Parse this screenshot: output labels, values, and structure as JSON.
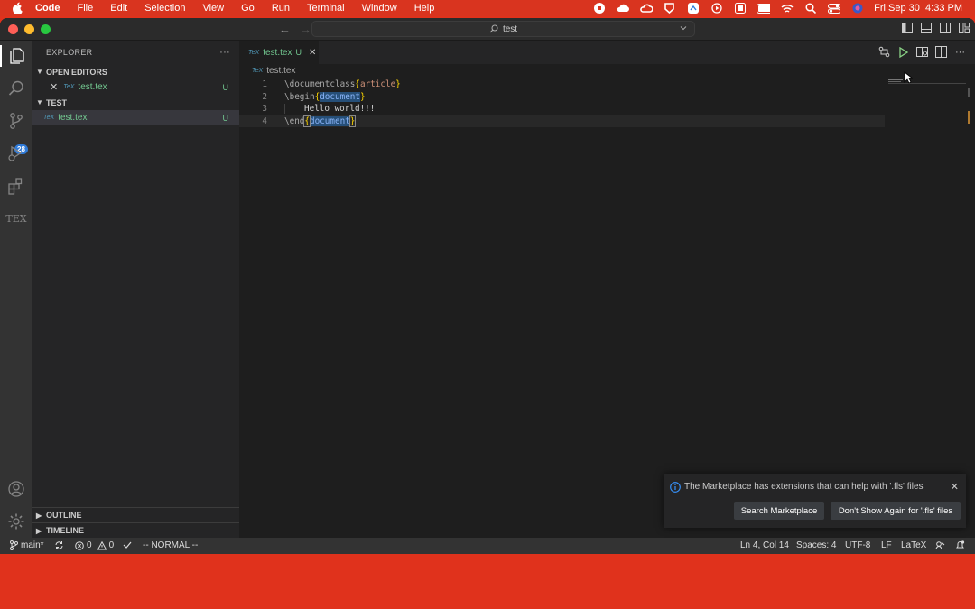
{
  "menubar": {
    "app_name": "Code",
    "items": [
      "File",
      "Edit",
      "Selection",
      "View",
      "Go",
      "Run",
      "Terminal",
      "Window",
      "Help"
    ],
    "clock": "Fri Sep 30  4:33 PM"
  },
  "titlebar": {
    "search_text": "test"
  },
  "activity_bar": {
    "scm_badge": "28",
    "tex_label": "TEX"
  },
  "sidebar": {
    "title": "EXPLORER",
    "more": "···",
    "open_editors": {
      "label": "OPEN EDITORS",
      "file": "test.tex",
      "status": "U"
    },
    "folder": {
      "label": "TEST",
      "file": "test.tex",
      "status": "U"
    },
    "outline_label": "OUTLINE",
    "timeline_label": "TIMELINE"
  },
  "tab": {
    "name": "test.tex",
    "status": "U"
  },
  "breadcrumb": "test.tex",
  "code": {
    "line_numbers": [
      "1",
      "2",
      "3",
      "4"
    ],
    "lines": [
      "\\documentclass{article}",
      "\\begin{document}",
      "    Hello world!!!",
      "\\end{document}"
    ],
    "tokens": {
      "l1_cmd": "\\documentclass",
      "l1_arg": "article",
      "l2_cmd": "\\begin",
      "l2_arg": "document",
      "l3_text": "Hello world!!!",
      "l4_cmd": "\\end",
      "l4_arg": "document"
    }
  },
  "notification": {
    "message": "The Marketplace has extensions that can help with '.fls' files",
    "btn_search": "Search Marketplace",
    "btn_dont_show": "Don't Show Again for '.fls' files"
  },
  "statusbar": {
    "branch": "main*",
    "errors": "0",
    "warnings": "0",
    "mode": "-- NORMAL --",
    "position": "Ln 4, Col 14",
    "spaces": "Spaces: 4",
    "encoding": "UTF-8",
    "eol": "LF",
    "language": "LaTeX"
  },
  "colors": {
    "accent": "#2f7ad8",
    "desktop": "#e0321c",
    "untracked": "#73c991"
  }
}
